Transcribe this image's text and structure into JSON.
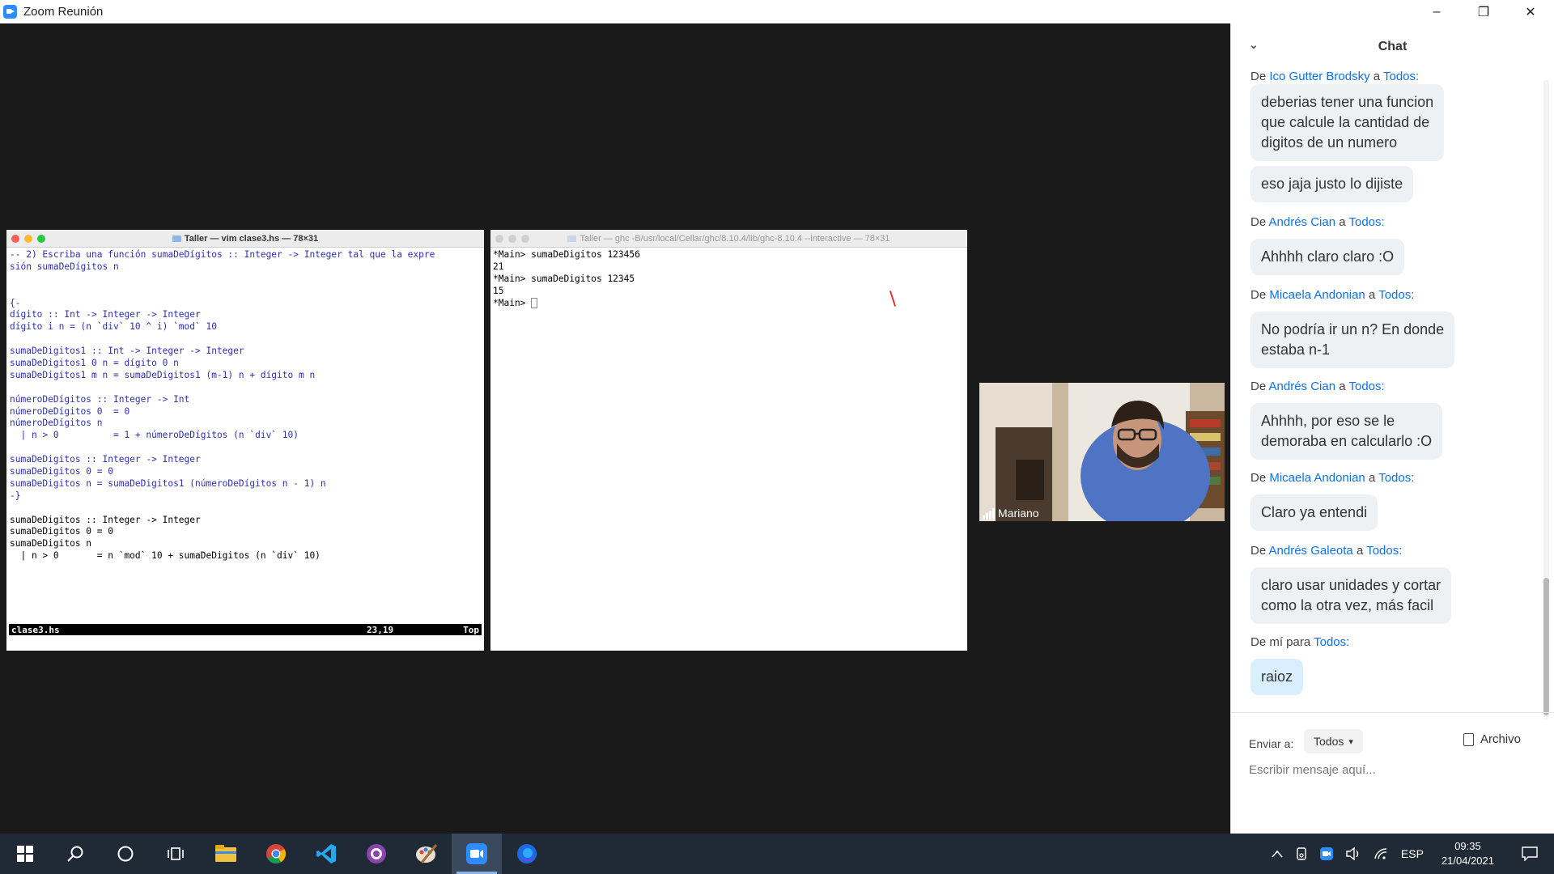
{
  "window": {
    "title": "Zoom Reunión",
    "minimize": "–",
    "restore": "❐",
    "close": "✕"
  },
  "vim": {
    "title": "Taller — vim clase3.hs — 78×31",
    "lines": [
      "-- 2) Escriba una función sumaDeDígitos :: Integer -> Integer tal que la expre",
      "sión sumaDeDígitos n",
      "",
      "",
      "{-",
      "dígito :: Int -> Integer -> Integer",
      "dígito i n = (n `div` 10 ^ i) `mod` 10",
      "",
      "sumaDeDigitos1 :: Int -> Integer -> Integer",
      "sumaDeDigitos1 0 n = dígito 0 n",
      "sumaDeDigitos1 m n = sumaDeDigitos1 (m-1) n + dígito m n",
      "",
      "númeroDeDígitos :: Integer -> Int",
      "númeroDeDígitos 0  = 0",
      "númeroDeDígitos n",
      "  | n > 0          = 1 + númeroDeDígitos (n `div` 10)",
      "",
      "sumaDeDigitos :: Integer -> Integer",
      "sumaDeDigitos 0 = 0",
      "sumaDeDigitos n = sumaDeDigitos1 (númeroDeDígitos n - 1) n",
      "-}",
      "",
      "sumaDeDigitos :: Integer -> Integer",
      "sumaDeDigitos 0 = 0",
      "sumaDeDigitos n",
      "  | n > 0       = n `mod` 10 + sumaDeDigitos (n `div` 10)"
    ],
    "status_file": "clase3.hs",
    "status_pos": "23,19",
    "status_scroll": "Top"
  },
  "ghci": {
    "title": "Taller — ghc -B/usr/local/Cellar/ghc/8.10.4/lib/ghc-8.10.4 --interactive — 78×31",
    "lines": [
      "*Main> sumaDeDigitos 123456",
      "21",
      "*Main> sumaDeDigitos 12345",
      "15"
    ],
    "prompt": "*Main> "
  },
  "video": {
    "participant": "Mariano"
  },
  "chat": {
    "header": "Chat",
    "messages": [
      {
        "from_prefix": "De",
        "sender": "Ico Gutter Brodsky",
        "to_sep": "a",
        "to": "Todos:",
        "texts": [
          "deberias tener una funcion\nque calcule la cantidad de\ndigitos de un numero",
          "eso jaja justo lo dijiste"
        ]
      },
      {
        "from_prefix": "De",
        "sender": "Andrés Cian",
        "to_sep": "a",
        "to": "Todos:",
        "texts": [
          "Ahhhh claro claro :O"
        ]
      },
      {
        "from_prefix": "De",
        "sender": "Micaela Andonian",
        "to_sep": "a",
        "to": "Todos:",
        "texts": [
          "No podría ir un n? En donde\nestaba n-1"
        ]
      },
      {
        "from_prefix": "De",
        "sender": "Andrés Cian",
        "to_sep": "a",
        "to": "Todos:",
        "texts": [
          "Ahhhh, por eso se le\ndemoraba en calcularlo :O"
        ]
      },
      {
        "from_prefix": "De",
        "sender": "Micaela Andonian",
        "to_sep": "a",
        "to": "Todos:",
        "texts": [
          "Claro ya entendi"
        ]
      },
      {
        "from_prefix": "De",
        "sender": "Andrés Galeota",
        "to_sep": "a",
        "to": "Todos:",
        "texts": [
          "claro usar unidades y cortar\ncomo la otra vez, más facil"
        ]
      },
      {
        "from_prefix": "De mí para",
        "sender": "",
        "to_sep": "",
        "to": "Todos:",
        "texts": [
          "raioz"
        ]
      }
    ],
    "send_to_label": "Enviar a:",
    "send_to_value": "Todos",
    "file_label": "Archivo",
    "input_placeholder": "Escribir mensaje aquí..."
  },
  "taskbar": {
    "language": "ESP",
    "time": "09:35",
    "date": "21/04/2021",
    "apps": [
      "start-icon",
      "search-icon",
      "cortana-icon",
      "task-view-icon",
      "file-explorer-icon",
      "chrome-icon",
      "vscode-icon",
      "github-desktop-icon",
      "paint-icon",
      "zoom-icon",
      "firefox-icon"
    ]
  },
  "colors": {
    "zoom_blue": "#2d8cff",
    "chat_link": "#0e71eb",
    "taskbar": "#1f2a36"
  }
}
